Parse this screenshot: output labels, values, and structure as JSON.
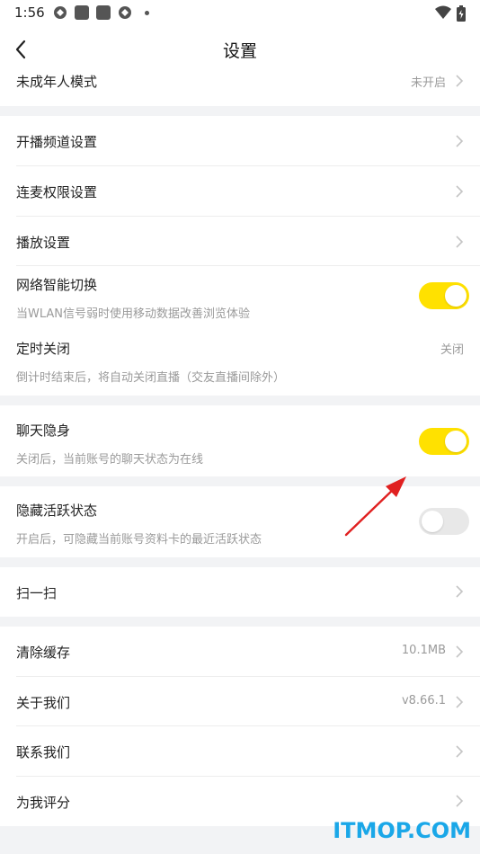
{
  "status_bar": {
    "time": "1:56"
  },
  "header": {
    "title": "设置"
  },
  "rows": {
    "minor_mode": {
      "label": "未成年人模式",
      "value": "未开启"
    },
    "channel": {
      "label": "开播频道设置"
    },
    "mic_permission": {
      "label": "连麦权限设置"
    },
    "playback": {
      "label": "播放设置"
    },
    "network": {
      "label": "网络智能切换",
      "sub": "当WLAN信号弱时使用移动数据改善浏览体验",
      "toggle": true
    },
    "timer": {
      "label": "定时关闭",
      "sub": "倒计时结束后，将自动关闭直播（交友直播间除外）",
      "value": "关闭"
    },
    "chat_invisible": {
      "label": "聊天隐身",
      "sub": "关闭后，当前账号的聊天状态为在线",
      "toggle": true
    },
    "hide_active": {
      "label": "隐藏活跃状态",
      "sub": "开启后，可隐藏当前账号资料卡的最近活跃状态",
      "toggle": false
    },
    "scan": {
      "label": "扫一扫"
    },
    "clear_cache": {
      "label": "清除缓存",
      "value": "10.1MB"
    },
    "about": {
      "label": "关于我们",
      "value": "v8.66.1"
    },
    "contact": {
      "label": "联系我们"
    },
    "rate": {
      "label": "为我评分"
    }
  },
  "watermark": "ITMOP.COM",
  "colors": {
    "toggle_on": "#ffe100",
    "toggle_off": "#e8e8e8",
    "annotation_arrow": "#e02020",
    "watermark": "#1aa7e8"
  }
}
